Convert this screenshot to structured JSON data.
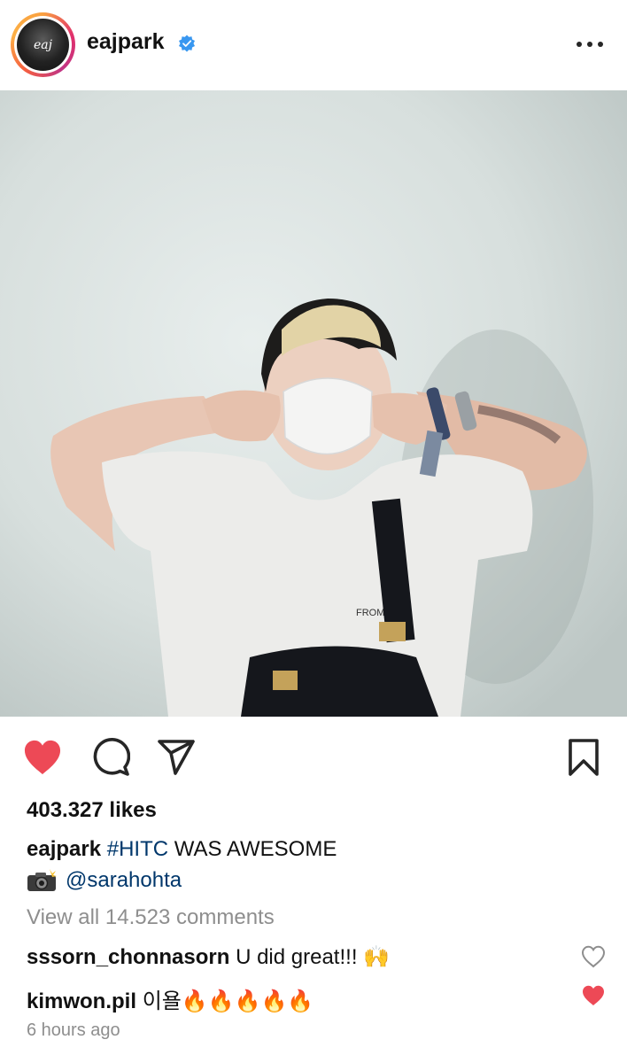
{
  "post": {
    "username": "eajpark",
    "avatar_text": "eaj",
    "verified": true,
    "more_icon": "more-horizontal-icon",
    "liked": true,
    "likes_text": "403.327 likes",
    "caption": {
      "username": "eajpark",
      "hashtag": "#HITC",
      "text": " WAS AWESOME",
      "line2_emoji": "camera-with-flash-icon",
      "mention": "@sarahohta"
    },
    "view_all_text": "View all 14.523 comments",
    "comments": [
      {
        "username": "sssorn_chonnasorn",
        "text": "U did great!!! 🙌",
        "liked": false
      },
      {
        "username": "kimwon.pil",
        "text": "이욜🔥🔥🔥🔥🔥",
        "liked": true
      }
    ],
    "time_text": "6 hours ago"
  },
  "colors": {
    "like_red": "#ed4956",
    "verified_blue": "#3897f0",
    "link_blue": "#00376b",
    "muted_gray": "#8e8e8e"
  }
}
